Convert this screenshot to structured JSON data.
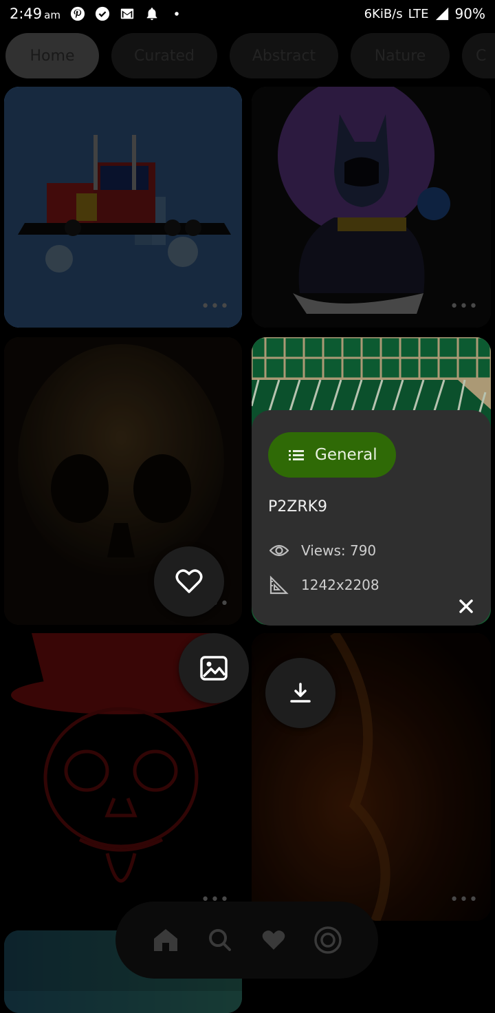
{
  "status": {
    "time": "2:49",
    "ampm": "am",
    "speed": "6KiB/s",
    "network": "LTE",
    "battery": "90%",
    "notif_icons": [
      "pinterest-icon",
      "check-circle-icon",
      "gmail-icon",
      "bell-icon",
      "dot-icon"
    ]
  },
  "categories": {
    "items": [
      "Home",
      "Curated",
      "Abstract",
      "Nature",
      "C"
    ]
  },
  "tiles": {
    "more_label": "•••"
  },
  "info_card": {
    "category": "General",
    "wallpaper_id": "P2ZRK9",
    "views": "Views: 790",
    "resolution": "1242x2208",
    "accent": "#2f6a06"
  },
  "actions": [
    "favorite-icon",
    "set-wallpaper-icon",
    "download-icon"
  ],
  "navbar": [
    "home-icon",
    "search-icon",
    "favorites-icon",
    "profile-icon"
  ]
}
